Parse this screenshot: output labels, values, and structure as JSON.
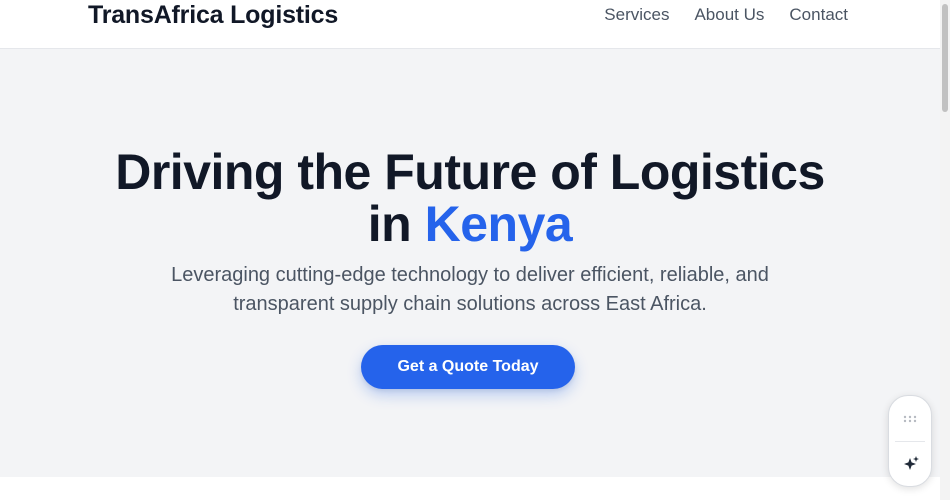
{
  "header": {
    "brand": "TransAfrica Logistics",
    "nav": [
      {
        "label": "Services"
      },
      {
        "label": "About Us"
      },
      {
        "label": "Contact"
      }
    ]
  },
  "hero": {
    "title_line1": "Driving the Future of Logistics",
    "title_line2_prefix": "in",
    "title_highlight": "Kenya",
    "subtitle": "Leveraging cutting-edge technology to deliver efficient, reliable, and transparent supply chain solutions across East Africa.",
    "cta_label": "Get a Quote Today"
  },
  "floating_widget": {
    "icons": [
      "grip-icon",
      "sparkle-icon"
    ]
  },
  "colors": {
    "accent": "#2563eb",
    "hero_bg": "#f3f4f6",
    "text_dark": "#111827",
    "text_muted": "#4b5563"
  }
}
